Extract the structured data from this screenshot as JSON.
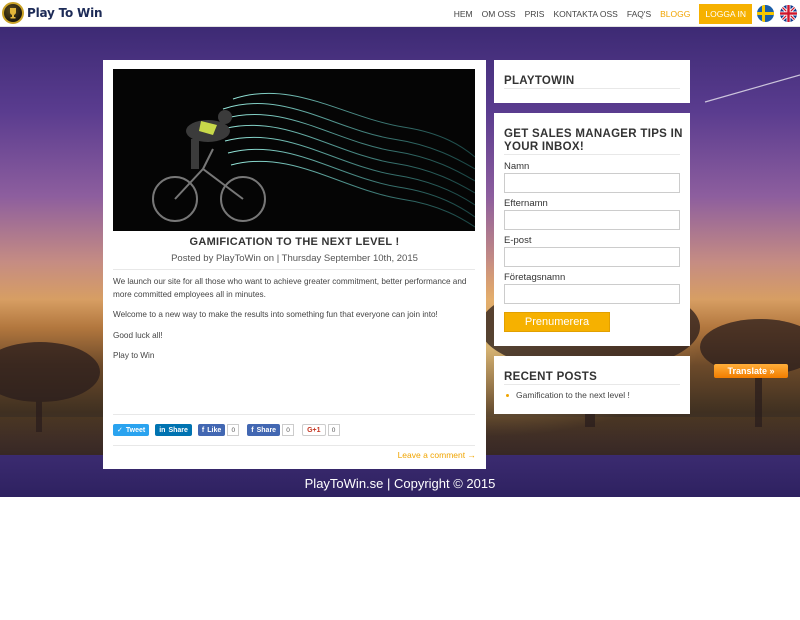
{
  "header": {
    "logo_text": "Play To Win",
    "nav": [
      "HEM",
      "OM OSS",
      "PRIS",
      "KONTAKTA OSS",
      "FAQ'S",
      "BLOGG"
    ],
    "active_nav": "BLOGG",
    "login_label": "LOGGA IN",
    "accent_color": "#f6b100"
  },
  "post": {
    "title": "GAMIFICATION TO THE NEXT LEVEL !",
    "meta": "Posted by PlayToWin on  | Thursday September 10th, 2015",
    "paragraphs": [
      "We launch our site for all those who want to achieve greater commitment, better performance and more committed employees all in minutes.",
      "Welcome to a new way to make the results into something fun that everyone can join into!",
      "Good luck all!",
      "Play to Win"
    ],
    "share": {
      "tweet": "Tweet",
      "linkedin": "Share",
      "fb_like": "Like",
      "fb_like_count": "0",
      "fb_share": "Share",
      "fb_share_count": "0",
      "gplus": "G+1",
      "gplus_count": "0"
    },
    "leave_comment": "Leave a comment →"
  },
  "sidebar": {
    "site_title": "PLAYTOWIN",
    "newsletter_title": "GET SALES MANAGER TIPS IN YOUR INBOX!",
    "fields": [
      "Namn",
      "Efternamn",
      "E-post",
      "Företagsnamn"
    ],
    "subscribe_label": "Prenumerera",
    "recent_title": "RECENT POSTS",
    "recent_posts": [
      "Gamification to the next level !"
    ]
  },
  "translate_label": "Translate »",
  "footer": "PlayToWin.se  |  Copyright © 2015"
}
